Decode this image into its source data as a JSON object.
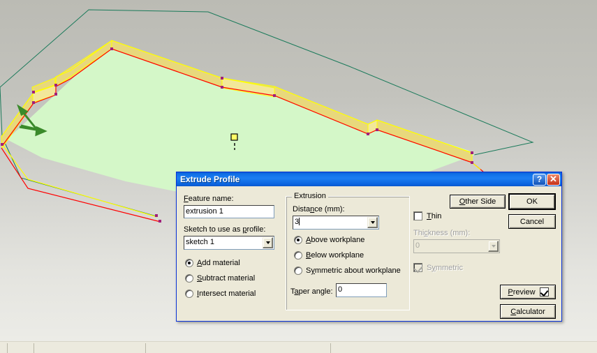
{
  "viewport": {
    "name": "cad-3d-viewport",
    "background_top": "#bbbbb4",
    "background_bottom": "#ececE7",
    "model": {
      "face_fill": "#d4f7c8",
      "wall_fill": "#efe08a",
      "profile_edge": "#ff0000",
      "wall_edge": "#ffff00",
      "workplane_edge": "#1a7a5a",
      "vertex": "#a0207a",
      "axis_arrow": "#3a8a2a",
      "cursor_marker": "#ffff66"
    }
  },
  "dialog": {
    "title": "Extrude Profile",
    "help_button": "?",
    "close_button": "✕",
    "feature_name_label": "Feature name:",
    "feature_name_value": "extrusion 1",
    "sketch_label": "Sketch to use as profile:",
    "sketch_value": "sketch 1",
    "material_options": [
      {
        "label": "Add material",
        "selected": true
      },
      {
        "label": "Subtract material",
        "selected": false
      },
      {
        "label": "Intersect material",
        "selected": false
      }
    ],
    "extrusion_group_title": "Extrusion",
    "distance_label": "Distance (mm):",
    "distance_value": "3",
    "workplane_options": [
      {
        "label": "Above workplane",
        "selected": true
      },
      {
        "label": "Below workplane",
        "selected": false
      },
      {
        "label": "Symmetric about workplane",
        "selected": false
      }
    ],
    "taper_label": "Taper angle:",
    "taper_value": "0",
    "thin_label": "Thin",
    "thin_checked": false,
    "thickness_label": "Thickness (mm):",
    "thickness_value": "0",
    "thickness_enabled": false,
    "symmetric_label": "Symmetric",
    "symmetric_checked": true,
    "symmetric_enabled": false,
    "other_side_button": "Other Side",
    "ok_button": "OK",
    "cancel_button": "Cancel",
    "preview_button": "Preview",
    "preview_checked": true,
    "calculator_button": "Calculator"
  },
  "statusbar": {
    "cells": [
      "",
      "",
      "",
      ""
    ]
  }
}
